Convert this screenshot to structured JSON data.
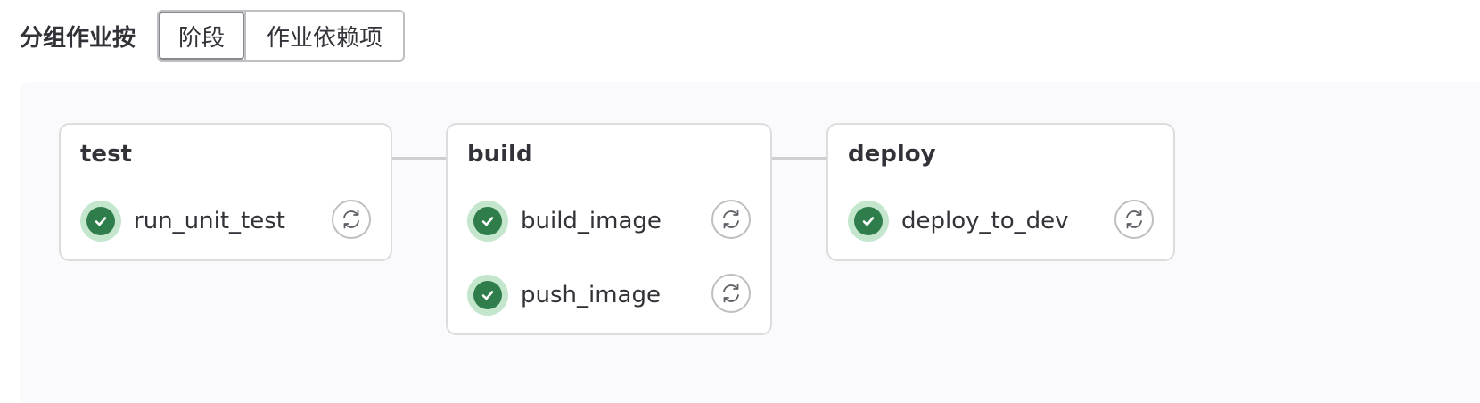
{
  "toolbar": {
    "group_label": "分组作业按",
    "options": [
      {
        "label": "阶段",
        "selected": true
      },
      {
        "label": "作业依赖项",
        "selected": false
      }
    ]
  },
  "stages": [
    {
      "name": "test",
      "jobs": [
        {
          "name": "run_unit_test",
          "status": "success",
          "action_icon": "retry-icon"
        }
      ]
    },
    {
      "name": "build",
      "jobs": [
        {
          "name": "build_image",
          "status": "success",
          "action_icon": "retry-icon"
        },
        {
          "name": "push_image",
          "status": "success",
          "action_icon": "retry-icon"
        }
      ]
    },
    {
      "name": "deploy",
      "jobs": [
        {
          "name": "deploy_to_dev",
          "status": "success",
          "action_icon": "retry-icon"
        }
      ]
    }
  ],
  "colors": {
    "success": "#2f7d4a",
    "success_ring": "#c3e6cd",
    "canvas_bg": "#fafafc",
    "border": "#dcdcde"
  }
}
